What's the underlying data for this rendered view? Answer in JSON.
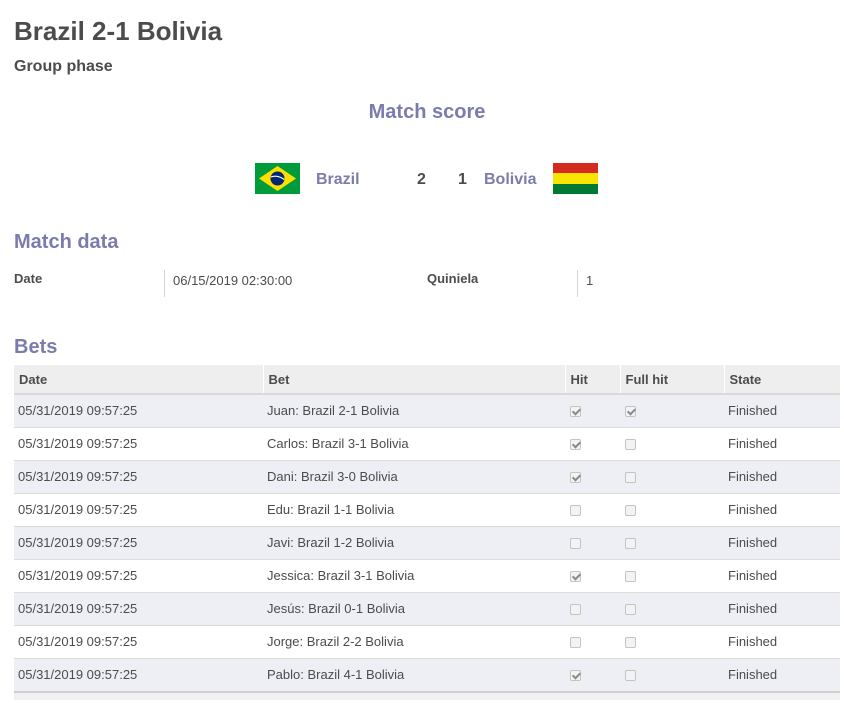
{
  "header": {
    "title": "Brazil 2-1 Bolivia",
    "subtitle": "Group phase"
  },
  "score": {
    "heading": "Match score",
    "home_team": "Brazil",
    "home_goals": "2",
    "away_goals": "1",
    "away_team": "Bolivia",
    "home_flag_icon": "brazil-flag-icon",
    "away_flag_icon": "bolivia-flag-icon"
  },
  "match_data": {
    "heading": "Match data",
    "date_label": "Date",
    "date_value": "06/15/2019 02:30:00",
    "quiniela_label": "Quiniela",
    "quiniela_value": "1"
  },
  "bets": {
    "heading": "Bets",
    "columns": [
      "Date",
      "Bet",
      "Hit",
      "Full hit",
      "State"
    ],
    "rows": [
      {
        "date": "05/31/2019 09:57:25",
        "bet": "Juan: Brazil 2-1 Bolivia",
        "hit": true,
        "full_hit": true,
        "state": "Finished"
      },
      {
        "date": "05/31/2019 09:57:25",
        "bet": "Carlos: Brazil 3-1 Bolivia",
        "hit": true,
        "full_hit": false,
        "state": "Finished"
      },
      {
        "date": "05/31/2019 09:57:25",
        "bet": "Dani: Brazil 3-0 Bolivia",
        "hit": true,
        "full_hit": false,
        "state": "Finished"
      },
      {
        "date": "05/31/2019 09:57:25",
        "bet": "Edu: Brazil 1-1 Bolivia",
        "hit": false,
        "full_hit": false,
        "state": "Finished"
      },
      {
        "date": "05/31/2019 09:57:25",
        "bet": "Javi: Brazil 1-2 Bolivia",
        "hit": false,
        "full_hit": false,
        "state": "Finished"
      },
      {
        "date": "05/31/2019 09:57:25",
        "bet": "Jessica: Brazil 3-1 Bolivia",
        "hit": true,
        "full_hit": false,
        "state": "Finished"
      },
      {
        "date": "05/31/2019 09:57:25",
        "bet": "Jesús: Brazil 0-1 Bolivia",
        "hit": false,
        "full_hit": false,
        "state": "Finished"
      },
      {
        "date": "05/31/2019 09:57:25",
        "bet": "Jorge: Brazil 2-2 Bolivia",
        "hit": false,
        "full_hit": false,
        "state": "Finished"
      },
      {
        "date": "05/31/2019 09:57:25",
        "bet": "Pablo: Brazil 4-1 Bolivia",
        "hit": true,
        "full_hit": false,
        "state": "Finished"
      }
    ]
  },
  "colors": {
    "accent": "#7c7bad",
    "text": "#4c4c4c",
    "row_stripe": "#eeeef5",
    "header_bg": "#eeeeee"
  }
}
